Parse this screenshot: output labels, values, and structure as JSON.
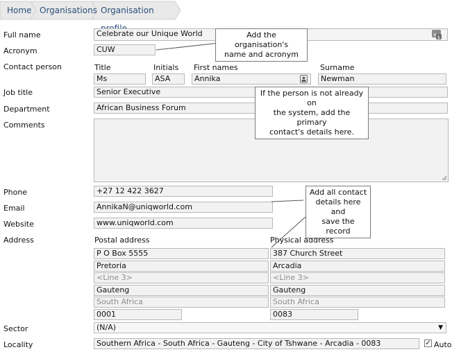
{
  "breadcrumb": {
    "items": [
      "Home",
      "Organisations",
      "Organisation profile"
    ]
  },
  "labels": {
    "full_name": "Full name",
    "acronym": "Acronym",
    "contact_person": "Contact person",
    "job_title": "Job title",
    "department": "Department",
    "comments": "Comments",
    "phone": "Phone",
    "email": "Email",
    "website": "Website",
    "address": "Address",
    "sector": "Sector",
    "locality": "Locality"
  },
  "contact": {
    "title_label": "Title",
    "title": "Ms",
    "initials_label": "Initials",
    "initials": "ASA",
    "first_names_label": "First names",
    "first_names": "Annika",
    "surname_label": "Surname",
    "surname": "Newman"
  },
  "fields": {
    "full_name": "Celebrate our Unique World",
    "acronym": "CUW",
    "job_title": "Senior Executive",
    "department": "African Business Forum",
    "comments": "",
    "phone": "+27 12 422 3627",
    "email": "AnnikaN@uniqworld.com",
    "website": "www.uniqworld.com"
  },
  "postal_address": {
    "label": "Postal address",
    "line1": "P O Box 5555",
    "line2": "Pretoria",
    "line3_placeholder": "<Line 3>",
    "province": "Gauteng",
    "country": "South Africa",
    "code": "0001"
  },
  "physical_address": {
    "label": "Physical address",
    "line1": "387 Church Street",
    "line2": "Arcadia",
    "line3_placeholder": "<Line 3>",
    "province": "Gauteng",
    "country": "South Africa",
    "code": "0083"
  },
  "sector": {
    "selected": "(N/A)"
  },
  "locality": {
    "value": "Southern Africa - South Africa - Gauteng - City of Tshwane - Arcadia - 0083",
    "auto_label": "Auto",
    "auto_checked": true
  },
  "callouts": {
    "name": [
      "Add the organisation's",
      "name and acronym"
    ],
    "person": [
      "If the person is not already on",
      "the system, add the primary",
      "contact's details here."
    ],
    "contact": [
      "Add all contact",
      "details here and",
      "save the record"
    ]
  },
  "colors": {
    "breadcrumb_text": "#2b4f7a",
    "field_bg": "#f2f2f2",
    "field_border": "#b8b8b8"
  }
}
